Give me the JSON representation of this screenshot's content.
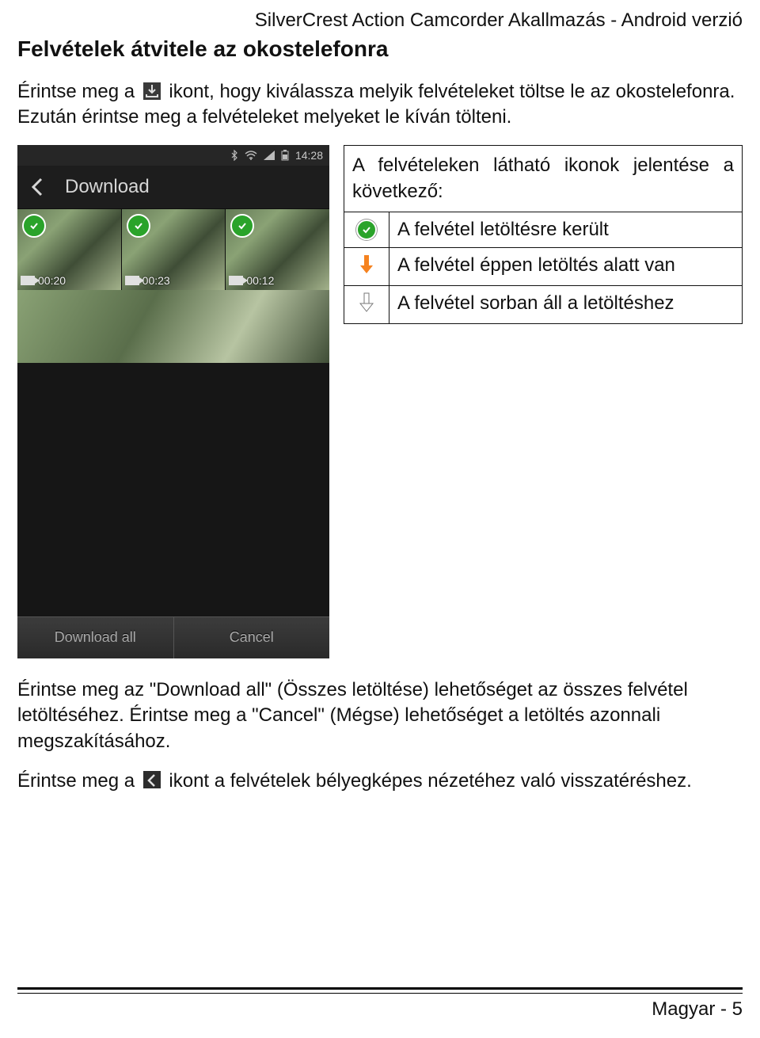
{
  "header": "SilverCrest Action Camcorder Akallmazás - Android verzió",
  "section_title": "Felvételek átvitele az okostelefonra",
  "para1_pre": "Érintse meg a ",
  "para1_post": " ikont, hogy kiválassza melyik felvételeket töltse le az okostelefonra. Ezután érintse meg a felvételeket melyeket le kíván tölteni.",
  "legend_intro": "A felvételeken látható ikonok jelentése a következő:",
  "legend": [
    {
      "text": "A felvétel letöltésre került"
    },
    {
      "text": "A felvétel éppen letöltés alatt van"
    },
    {
      "text": "A felvétel sorban áll a letöltéshez"
    }
  ],
  "para2": "Érintse meg az \"Download all\" (Összes letöltése) lehetőséget az összes felvétel letöltéséhez. Érintse meg a \"Cancel\" (Mégse) lehetőséget a letöltés azonnali megszakításához.",
  "para3_pre": "Érintse meg a ",
  "para3_post": " ikont a felvételek bélyegképes nézetéhez való visszatéréshez.",
  "footer": "Magyar - 5",
  "phone": {
    "time": "14:28",
    "title": "Download",
    "thumbs": [
      {
        "duration": "00:20"
      },
      {
        "duration": "00:23"
      },
      {
        "duration": "00:12"
      }
    ],
    "buttons": {
      "download_all": "Download all",
      "cancel": "Cancel"
    }
  }
}
